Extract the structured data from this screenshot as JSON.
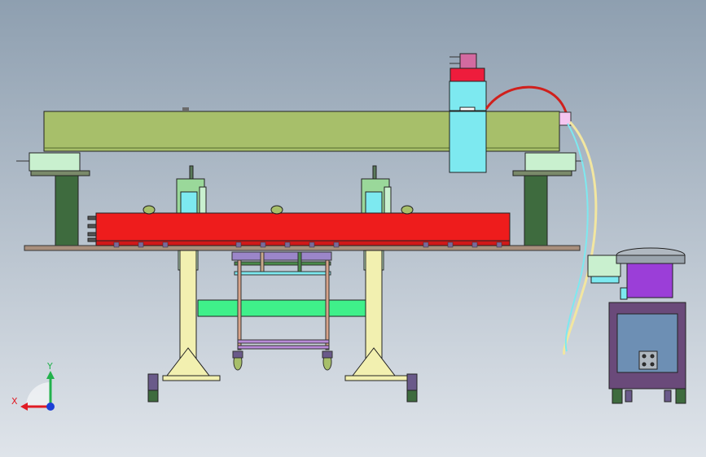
{
  "viewport": {
    "background_top": "#8e9fb0",
    "background_bottom": "#dfe4ea"
  },
  "triad": {
    "x_label": "X",
    "y_label": "Y",
    "x_color": "#e01b24",
    "y_color": "#22b14c",
    "z_color": "#1c3fd6"
  },
  "model_colors": {
    "beam": "#a7bf6a",
    "red_body": "#ee1c1c",
    "cyan": "#7de9f0",
    "pale_yellow": "#f2f0b0",
    "green_bar": "#3ff08a",
    "dark_green": "#3e6b3e",
    "violet": "#9b3ed8",
    "steel_blue": "#6d8fb4",
    "plate": "#a88f7c"
  },
  "icons": [
    "view-triad-icon"
  ]
}
